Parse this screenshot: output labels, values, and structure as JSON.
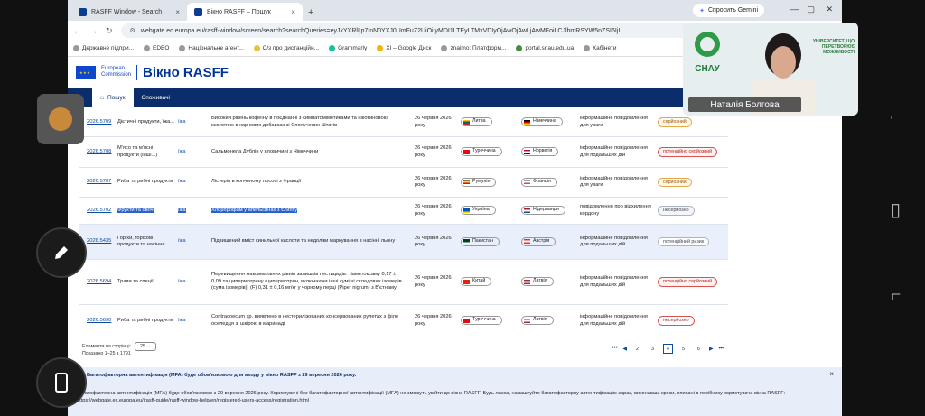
{
  "browser": {
    "tabs": [
      {
        "label": "RASFF Window - Search",
        "active": false
      },
      {
        "label": "Вікно RASFF – Пошук",
        "active": true
      }
    ],
    "new_tab": "+",
    "gemini": "Спросить Gemini",
    "url": "webgate.ec.europa.eu/rasff-window/screen/search?searchQueries=eyJkYXRlIjp7InN0YXJ0UmFuZ2UiOiIyMDI1LTEyLTMxVDIyOjAwOjAwLjAwMFoiLCJlbmRSYW5nZSI6IjI",
    "bookmarks": [
      "Державне підпри...",
      "EDBO",
      "Національне агент...",
      "С/з про дистанційн...",
      "Grammarly",
      "XI – Google Диск",
      "znaimo: Платформ...",
      "portal.snau.edu.ua",
      "Кабінети"
    ]
  },
  "site": {
    "ec_line1": "European",
    "ec_line2": "Commission",
    "brand": "Вікно RASFF",
    "menu": [
      {
        "label": "Пошук",
        "active": true
      },
      {
        "label": "Споживачі",
        "active": false
      }
    ]
  },
  "table": {
    "rows": [
      {
        "ref": "2026.5709",
        "category": "Дієтичні продукти, їжа...",
        "type": "їжа",
        "subject": "Високий рівень кофеїну в поєднанні з симпатоміметиками та нікотиновою кислотою в харчових добавках зі Сполучених Штатів",
        "date": "26 червня 2026 року",
        "notif": {
          "name": "Литва",
          "flag": "lt"
        },
        "origin": {
          "name": "Німеччина",
          "flag": "de"
        },
        "classification": "інформаційне повідомлення для уваги",
        "risk": {
          "label": "серйозний",
          "kind": "serious"
        },
        "h": 32
      },
      {
        "ref": "2026.5708",
        "category": "М'ясо та м'ясні продукти (інші...)",
        "type": "їжа",
        "subject": "Сальмонела Дублін у яловичині з Німеччини",
        "date": "26 червня 2026 року",
        "notif": {
          "name": "Туреччина",
          "flag": "tr"
        },
        "origin": {
          "name": "Норвегія",
          "flag": "no"
        },
        "classification": "інформаційне повідомлення для подальших дій",
        "risk": {
          "label": "потенційно серйозний",
          "kind": "potserious"
        },
        "h": 34
      },
      {
        "ref": "2026.5707",
        "category": "Риба та рибні продукти",
        "type": "їжа",
        "subject": "Лістерія в копченому лососі з Франції",
        "date": "26 червня 2026 року",
        "notif": {
          "name": "Румунія",
          "flag": "ro"
        },
        "origin": {
          "name": "Франція",
          "flag": "fr"
        },
        "classification": "інформаційне повідомлення для уваги",
        "risk": {
          "label": "серйозний",
          "kind": "serious"
        },
        "h": 33
      },
      {
        "ref": "2026.5702",
        "category": "Фрукти та овочі",
        "type": "їжа",
        "subject": "Хлорпрофам у апельсинах з Єгипту",
        "date": "26 червня 2026 року",
        "notif": {
          "name": "Україна",
          "flag": "ua"
        },
        "origin": {
          "name": "Нідерланди",
          "flag": "nl"
        },
        "classification": "повідомлення про відхилення кордону",
        "risk": {
          "label": "несерйозно",
          "kind": "undecided"
        },
        "h": 30,
        "selected": true
      },
      {
        "ref": "2026.5435",
        "category": "Горіхи, горіхові продукти та насіння",
        "type": "їжа",
        "subject": "Підвищений вміст синильної кислоти та недоліки маркування в насінні льону",
        "date": "26 червня 2026 року",
        "notif": {
          "name": "Пакистан",
          "flag": "pk"
        },
        "origin": {
          "name": "Австрія",
          "flag": "at"
        },
        "classification": "інформаційне повідомлення для подальших дій",
        "risk": {
          "label": "потенційний ризик",
          "kind": "potrisk"
        },
        "h": 39,
        "highlight": true
      },
      {
        "ref": "2026.5694",
        "category": "Трави та спеції",
        "type": "їжа",
        "subject": "Перевищення максимальних рівнів залишків пестицидів: тіаметоксаму 0,17 ± 0,09 та ципермотрину (ципермотрин, включаючи інші суміші складових ізомерів (сума ізомерів)) (F) 0,31 ± 0,16 мг/кг у чорному перці (Piper nigrum) з В'єтнаму",
        "date": "26 червня 2026 року",
        "notif": {
          "name": "Китай",
          "flag": "cn"
        },
        "origin": {
          "name": "Латвія",
          "flag": "lv"
        },
        "classification": "інформаційне повідомлення для подальших дій",
        "risk": {
          "label": "потенційно серйозний",
          "kind": "potserious"
        },
        "h": 50
      },
      {
        "ref": "2026.5690",
        "category": "Риба та рибні продукти",
        "type": "їжа",
        "subject": "Contracoecum sp. виявлено в нестерилізованих консервованих рулетах з філе оселедця зі шкірою в маринаді",
        "date": "26 червня 2026 року",
        "notif": {
          "name": "Туреччина",
          "flag": "tr"
        },
        "origin": {
          "name": "Латвія",
          "flag": "lv"
        },
        "classification": "інформаційне повідомлення для подальших дій",
        "risk": {
          "label": "несерйозно",
          "kind": "notserious"
        },
        "h": 36
      }
    ]
  },
  "pager": {
    "per_page_label": "Елементи на сторінці:",
    "per_page_value": "25",
    "shown": "Показано 1–25 з 1791",
    "pages": [
      "2",
      "3",
      "4",
      "5",
      "6"
    ],
    "current": "4",
    "first": "⏮",
    "prev": "◀",
    "next": "▶",
    "last": "⏭"
  },
  "mfa": {
    "title": "Багатофакторна автентифікація (MFA) буде обов'язковою для входу у вікно RASFF з 29 вересня 2026 року.",
    "body": "Багатофакторна автентифікація (MFA) буде обов'язковою з 29 вересня 2026 року. Користувачі без багатофакторної автентифікації (MFA) не зможуть увійти до вікна RASFF. Будь ласка, налаштуйте багатофакторну автентифікацію зараз, виконавши кроки, описані в посібнику користувача вікна RASFF: https://webgate.ec.europa.eu/irasff-guide/rasff-window-help/en/registered-users-access/registration.html",
    "close": "×"
  },
  "video": {
    "logo_text": "СНАУ",
    "banner_text": "УНІВЕРСИТЕТ, ЩО ПЕРЕТВОРЮЄ МОЖЛИВОСТІ",
    "name": "Наталія Болгова"
  },
  "colors": {
    "navy": "#0c2d6b",
    "link": "#0c4da2",
    "accent": "#2a62c9"
  }
}
